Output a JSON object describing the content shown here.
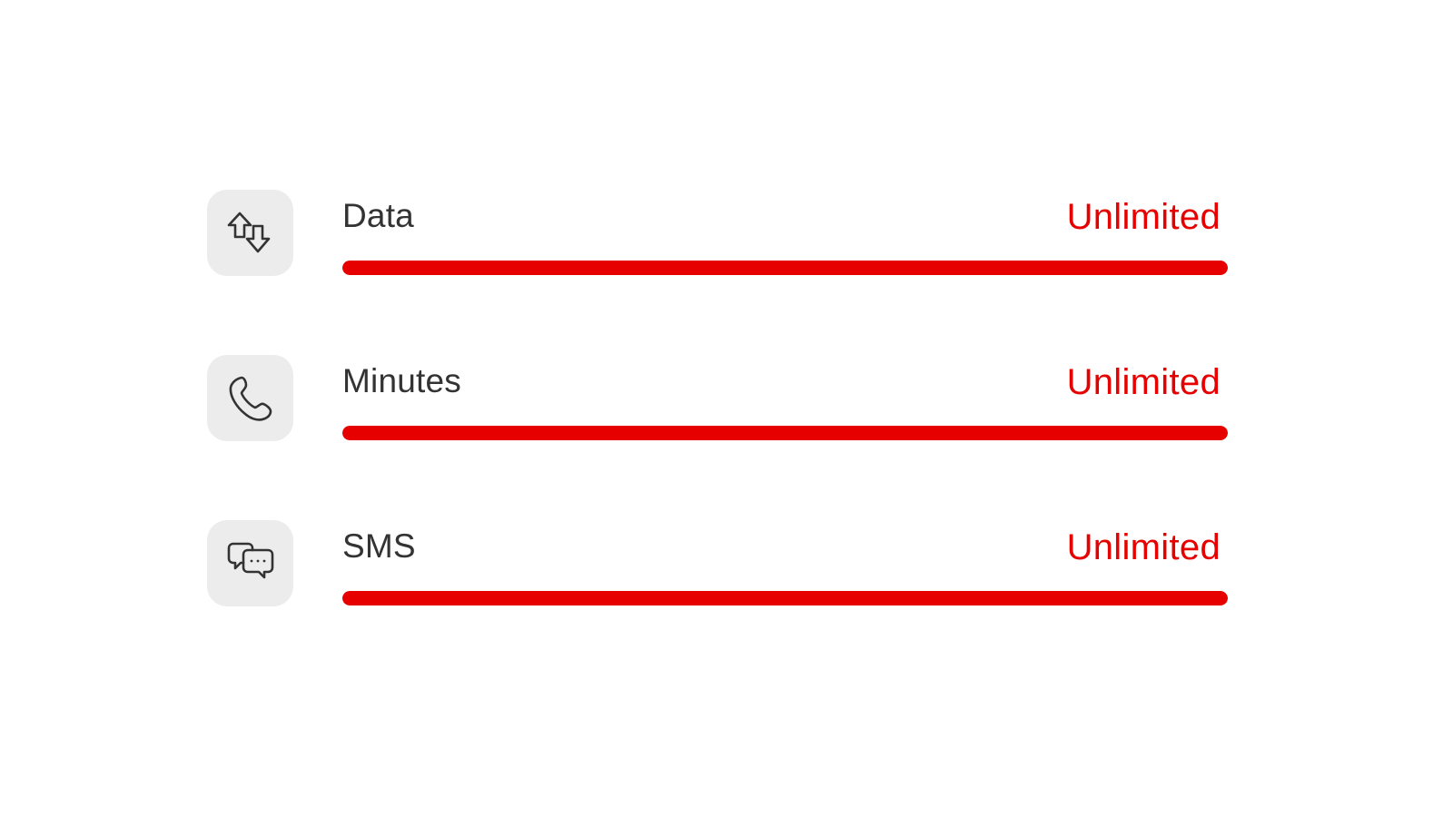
{
  "colors": {
    "accent": "#e60000",
    "icon_tile": "#ececec",
    "label_text": "#333333"
  },
  "usage": {
    "items": [
      {
        "label": "Data",
        "value": "Unlimited",
        "icon": "data-transfer-icon",
        "fill_fraction": 1.0
      },
      {
        "label": "Minutes",
        "value": "Unlimited",
        "icon": "phone-icon",
        "fill_fraction": 1.0
      },
      {
        "label": "SMS",
        "value": "Unlimited",
        "icon": "chat-bubbles-icon",
        "fill_fraction": 1.0
      }
    ]
  }
}
